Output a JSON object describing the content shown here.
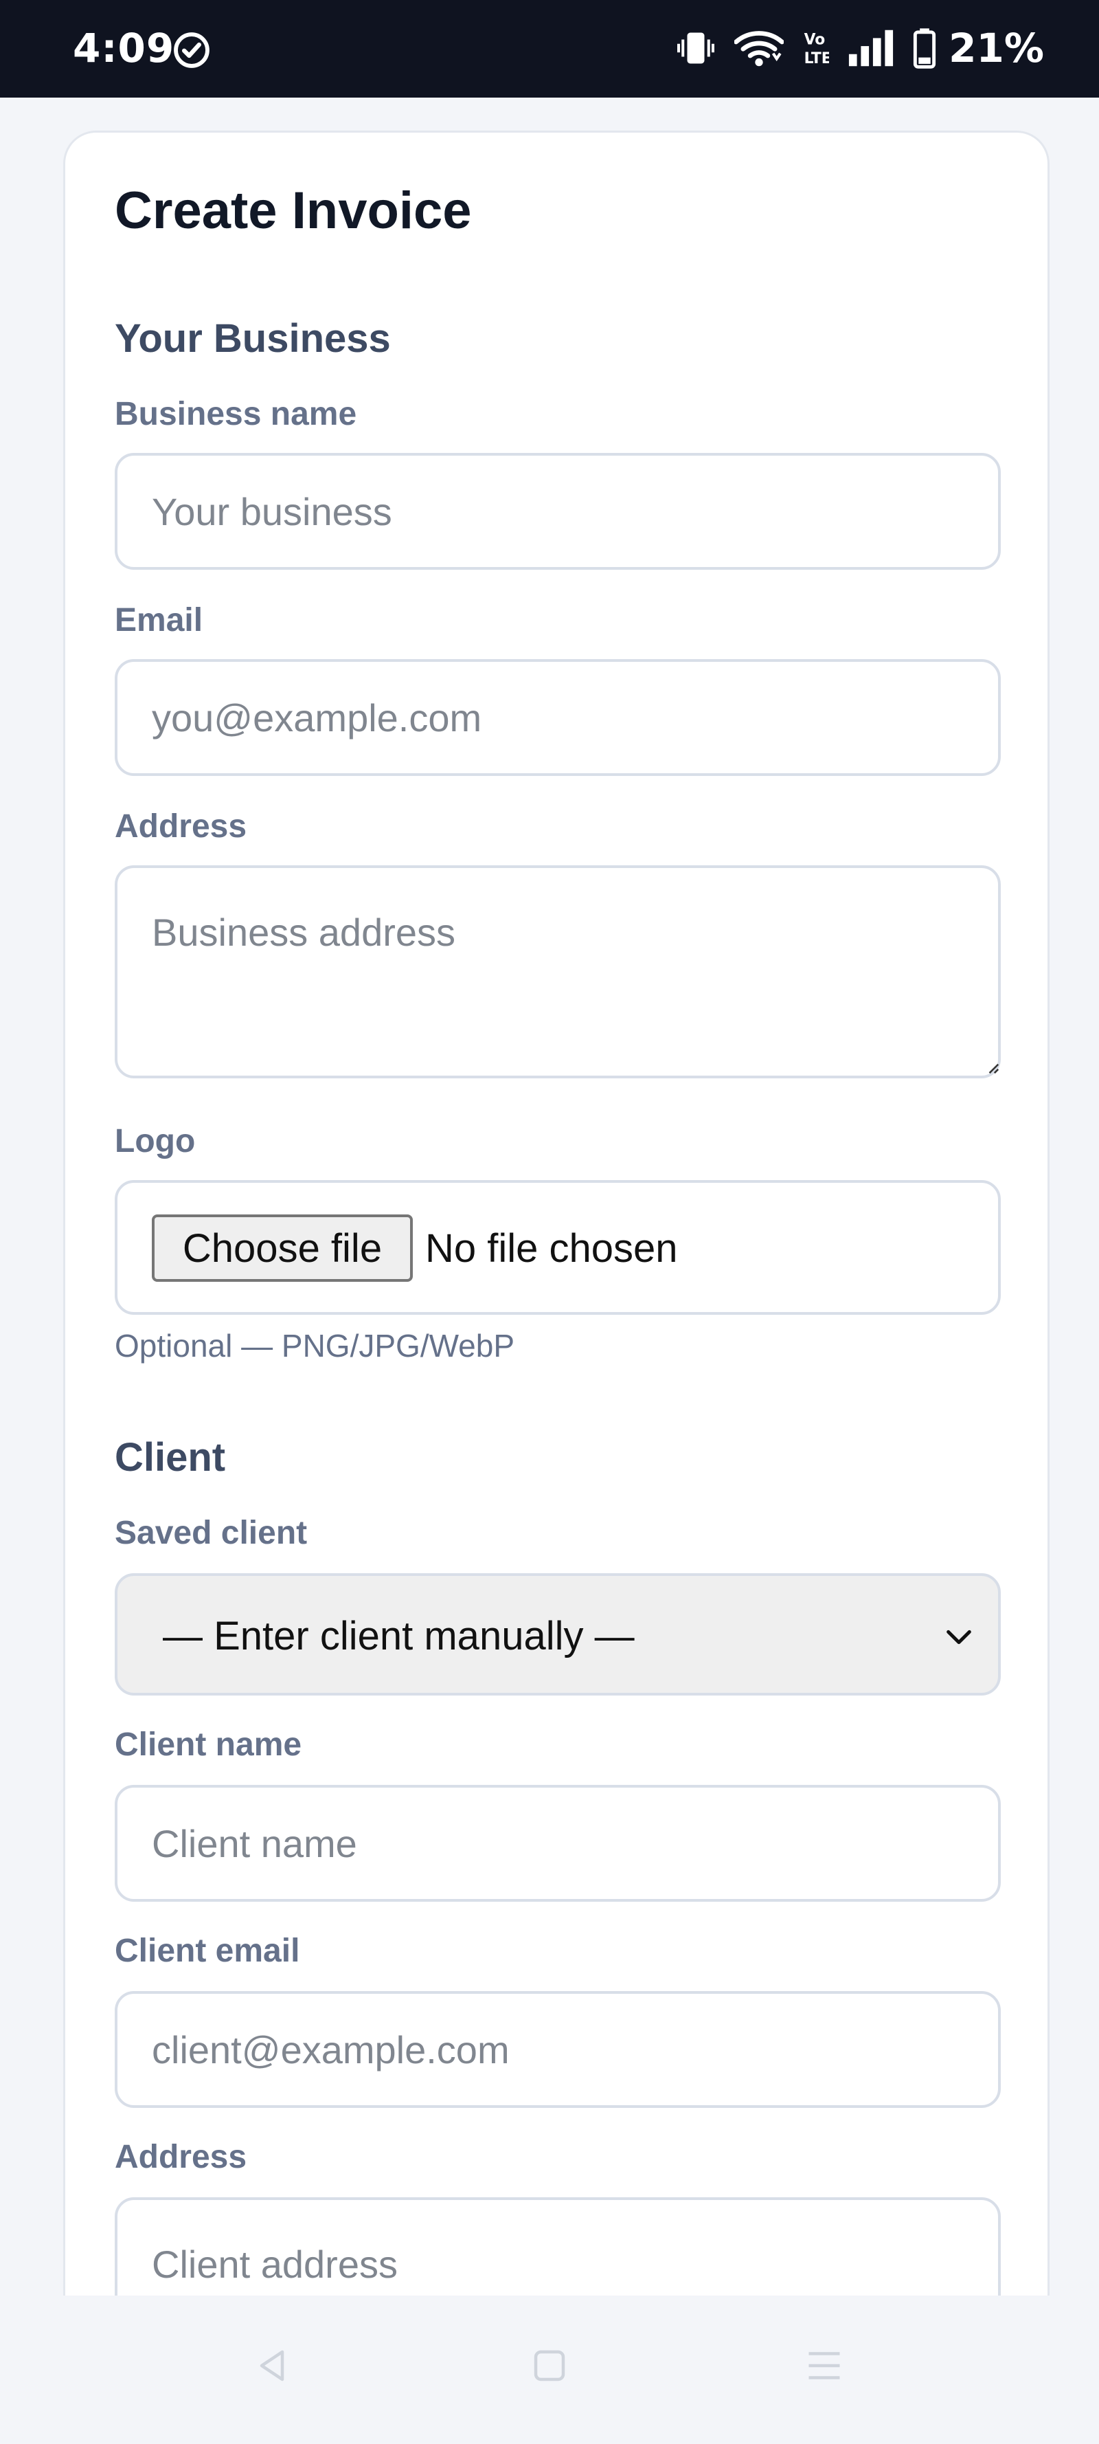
{
  "status_bar": {
    "time": "4:09",
    "battery": "21%",
    "icons": [
      "check-circle-icon",
      "vibrate-icon",
      "wifi-icon",
      "volte-icon",
      "signal-icon",
      "battery-icon"
    ]
  },
  "form": {
    "title": "Create Invoice",
    "business": {
      "heading": "Your Business",
      "name_label": "Business name",
      "name_placeholder": "Your business",
      "email_label": "Email",
      "email_placeholder": "you@example.com",
      "address_label": "Address",
      "address_placeholder": "Business address",
      "logo_label": "Logo",
      "logo_button": "Choose file",
      "logo_status": "No file chosen",
      "logo_help": "Optional — PNG/JPG/WebP"
    },
    "client": {
      "heading": "Client",
      "saved_label": "Saved client",
      "saved_selected": "— Enter client manually —",
      "name_label": "Client name",
      "name_placeholder": "Client name",
      "email_label": "Client email",
      "email_placeholder": "client@example.com",
      "address_label": "Address",
      "address_placeholder": "Client address"
    }
  },
  "nav_bar": {
    "icons": [
      "back-icon",
      "home-icon",
      "recents-icon"
    ]
  },
  "colors": {
    "status_bar_bg": "#0f1320",
    "page_bg": "#f3f5f9",
    "title_text": "#111827",
    "section_text": "#3d4a63",
    "label_text": "#65718a",
    "input_border": "#d8dee8"
  }
}
